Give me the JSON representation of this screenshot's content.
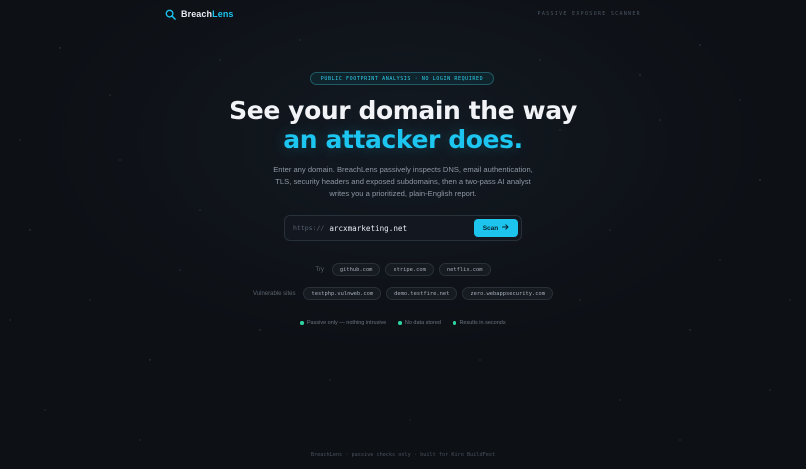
{
  "header": {
    "brand_part1": "Breach",
    "brand_part2": "Lens",
    "tagline": "PASSIVE EXPOSURE SCANNER"
  },
  "hero": {
    "badge": "PUBLIC FOOTPRINT ANALYSIS · NO LOGIN REQUIRED",
    "headline_line1": "See your domain the way",
    "headline_line2": "an attacker does.",
    "description": "Enter any domain. BreachLens passively inspects DNS, email authentication, TLS, security headers and exposed subdomains, then a two-pass AI analyst writes you a prioritized, plain-English report."
  },
  "search": {
    "prefix": "https://",
    "value": "arcxmarketing.net",
    "button_label": "Scan",
    "button_icon": "arrow-right-icon"
  },
  "suggestions": {
    "try_label": "Try",
    "try_domains": [
      "github.com",
      "stripe.com",
      "netflix.com"
    ],
    "vulnerable_label": "Vulnerable sites",
    "vulnerable_domains": [
      "testphp.vulnweb.com",
      "demo.testfire.net",
      "zero.webappsecurity.com"
    ]
  },
  "features": [
    "Passive only — nothing intrusive",
    "No data stored",
    "Results in seconds"
  ],
  "footer": "BreachLens · passive checks only · built for Kiro BuildFest",
  "colors": {
    "background": "#0d1015",
    "accent": "#1cc6f0",
    "feature_dot": "#2fd3a0"
  }
}
